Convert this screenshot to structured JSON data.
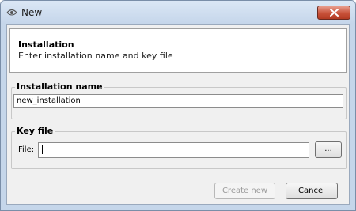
{
  "window": {
    "title": "New",
    "app_icon": "eye-icon",
    "close_icon": "close-x-icon"
  },
  "header": {
    "title": "Installation",
    "subtitle": "Enter installation name and key file"
  },
  "installation_group": {
    "label": "Installation name",
    "value": "new_installation"
  },
  "key_file_group": {
    "label": "Key file",
    "file_label": "File:",
    "file_value": "",
    "browse_label": "..."
  },
  "buttons": {
    "create_label": "Create new",
    "create_enabled": false,
    "cancel_label": "Cancel"
  },
  "colors": {
    "frame": "#c5d6ea",
    "close_button": "#c8523a",
    "client_bg": "#f0f0f0"
  }
}
